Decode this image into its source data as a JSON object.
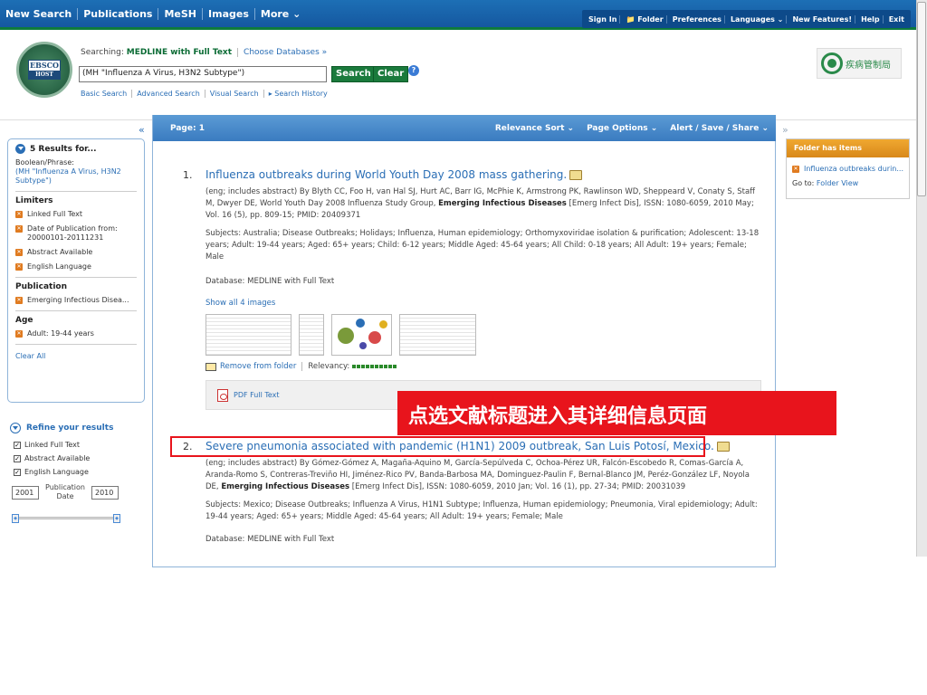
{
  "top_nav": {
    "items": [
      "New Search",
      "Publications",
      "MeSH",
      "Images",
      "More ⌄"
    ]
  },
  "top_links": {
    "items": [
      "Sign In",
      "📁 Folder",
      "Preferences",
      "Languages ⌄",
      "New Features!",
      "Help",
      "Exit"
    ]
  },
  "logo": {
    "line1": "EBSCO",
    "line2": "HOST"
  },
  "search": {
    "searching_label": "Searching:",
    "database": "MEDLINE with Full Text",
    "choose_db": "Choose Databases »",
    "query": "(MH \"Influenza A Virus, H3N2 Subtype\")",
    "search_btn": "Search",
    "clear_btn": "Clear",
    "help": "?"
  },
  "sublinks": [
    "Basic Search",
    "Advanced Search",
    "Visual Search",
    "▸ Search History"
  ],
  "partner_logo_text": "疾病管制局",
  "collapse_left": "«",
  "collapse_right": "»",
  "left_panel": {
    "results_heading": "5 Results for...",
    "boolean_label": "Boolean/Phrase:",
    "boolean_value": "(MH \"Influenza A Virus, H3N2 Subtype\")",
    "limiters_heading": "Limiters",
    "limiters": [
      "Linked Full Text",
      "Date of Publication from: 20000101-20111231",
      "Abstract Available",
      "English Language"
    ],
    "publication_heading": "Publication",
    "publication": "Emerging Infectious Disea...",
    "age_heading": "Age",
    "age": "Adult: 19-44 years",
    "clear_all": "Clear All"
  },
  "refine": {
    "heading": "Refine your results",
    "checkboxes": [
      "Linked Full Text",
      "Abstract Available",
      "English Language"
    ],
    "date_from": "2001",
    "date_label": "Publication Date",
    "date_to": "2010"
  },
  "main": {
    "page_label": "Page: 1",
    "sort": "Relevance Sort ⌄",
    "page_options": "Page Options ⌄",
    "alert": "Alert / Save / Share ⌄"
  },
  "results": [
    {
      "num": "1.",
      "title": "Influenza outbreaks during World Youth Day 2008 mass gathering.",
      "meta": "(eng; includes abstract) By Blyth CC, Foo H, van Hal SJ, Hurt AC, Barr IG, McPhie K, Armstrong PK, Rawlinson WD, Sheppeard V, Conaty S, Staff M, Dwyer DE, World Youth Day 2008 Influenza Study Group, Emerging Infectious Diseases [Emerg Infect Dis], ISSN: 1080-6059, 2010 May; Vol. 16 (5), pp. 809-15; PMID: 20409371",
      "subjects": "Subjects: Australia; Disease Outbreaks; Holidays; Influenza, Human epidemiology; Orthomyxoviridae isolation & purification; Adolescent: 13-18 years; Adult: 19-44 years; Aged: 65+ years; Child: 6-12 years; Middle Aged: 45-64 years; All Child: 0-18 years; All Adult: 19+ years; Female; Male",
      "database": "Database: MEDLINE with Full Text",
      "images_link": "Show all 4 images",
      "remove": "Remove from folder",
      "relevancy": "Relevancy:",
      "pdf": "PDF Full Text"
    },
    {
      "num": "2.",
      "title": "Severe pneumonia associated with pandemic (H1N1) 2009 outbreak, San Luis Potosí, Mexico.",
      "meta": "(eng; includes abstract) By Gómez-Gómez A, Magaña-Aquino M, García-Sepúlveda C, Ochoa-Pérez UR, Falcón-Escobedo R, Comas-García A, Aranda-Romo S, Contreras-Treviño HI, Jiménez-Rico PV, Banda-Barbosa MA, Dominguez-Paulin F, Bernal-Blanco JM, Peréz-González LF, Noyola DE, Emerging Infectious Diseases [Emerg Infect Dis], ISSN: 1080-6059, 2010 Jan; Vol. 16 (1), pp. 27-34; PMID: 20031039",
      "subjects": "Subjects: Mexico; Disease Outbreaks; Influenza A Virus, H1N1 Subtype; Influenza, Human epidemiology; Pneumonia, Viral epidemiology; Adult: 19-44 years; Aged: 65+ years; Middle Aged: 45-64 years; All Adult: 19+ years; Female; Male",
      "database": "Database: MEDLINE with Full Text"
    }
  ],
  "annotation": "点选文献标题进入其详细信息页面",
  "right_panel": {
    "heading": "Folder has items",
    "item": "Influenza outbreaks durin...",
    "goto_label": "Go to:",
    "goto_link": "Folder View"
  },
  "colors": {
    "topbar": "#1558a0",
    "accent_green": "#1a7a3c",
    "link": "#2a6eb5",
    "annotation": "#e8141c",
    "folder_header": "#e09a25"
  }
}
